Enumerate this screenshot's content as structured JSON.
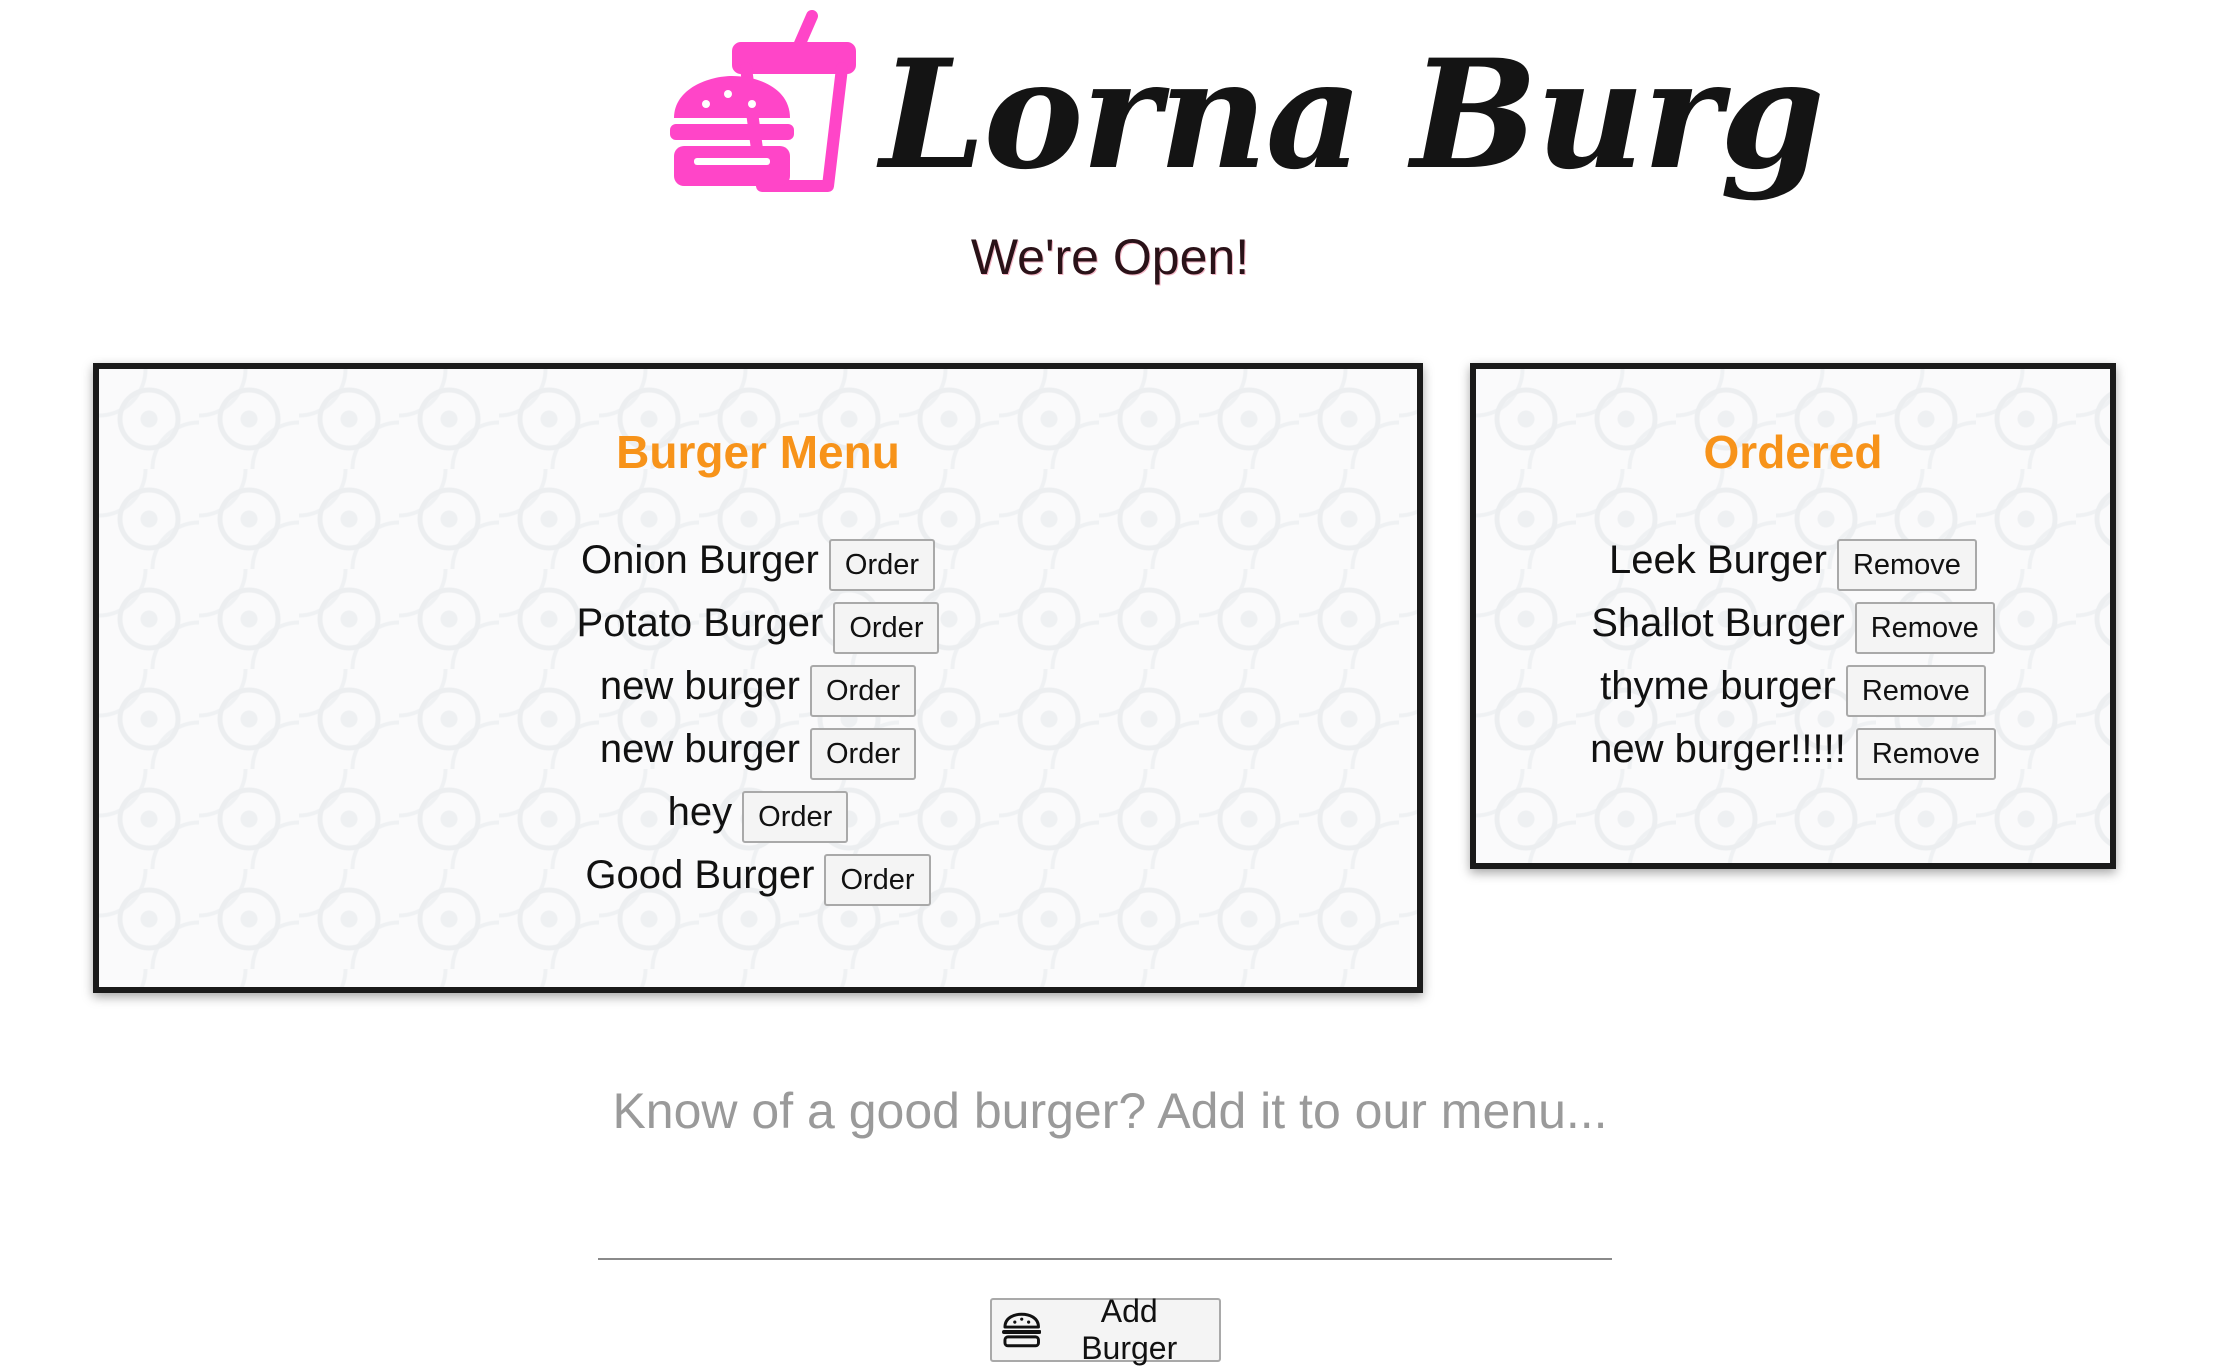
{
  "header": {
    "brand_name": "Lorna Burg",
    "status": "We're Open!",
    "logo_icon": "burger-and-drink-icon",
    "logo_color": "#ff45c8"
  },
  "menu": {
    "title": "Burger Menu",
    "title_color": "#f7931a",
    "button_label": "Order",
    "items": [
      {
        "name": "Onion Burger"
      },
      {
        "name": "Potato Burger"
      },
      {
        "name": "new burger"
      },
      {
        "name": "new burger"
      },
      {
        "name": "hey"
      },
      {
        "name": "Good Burger"
      }
    ]
  },
  "ordered": {
    "title": "Ordered",
    "title_color": "#f7931a",
    "button_label": "Remove",
    "items": [
      {
        "name": "Leek Burger"
      },
      {
        "name": "Shallot Burger"
      },
      {
        "name": "thyme burger"
      },
      {
        "name": "new burger!!!!!"
      }
    ]
  },
  "add_form": {
    "prompt": "Know of a good burger? Add it to our menu...",
    "input_value": "",
    "button_label": "Add Burger",
    "button_icon": "burger-icon"
  }
}
